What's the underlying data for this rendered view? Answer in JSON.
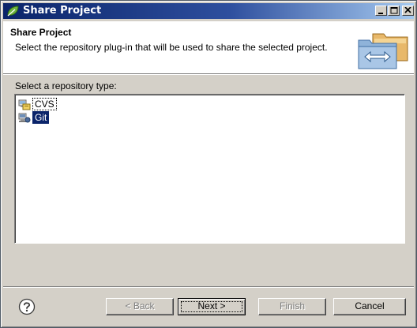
{
  "window": {
    "title": "Share Project"
  },
  "header": {
    "title": "Share Project",
    "description": "Select the repository plug-in that will be used to share the selected project."
  },
  "repository": {
    "label": "Select a repository type:",
    "items": [
      {
        "label": "CVS",
        "icon": "cvs-icon",
        "selected": false
      },
      {
        "label": "Git",
        "icon": "git-icon",
        "selected": true
      }
    ]
  },
  "buttons": {
    "back": "< Back",
    "next": "Next >",
    "finish": "Finish",
    "cancel": "Cancel"
  },
  "colors": {
    "title_bar_start": "#0a246a",
    "title_bar_end": "#a6caf0",
    "selection": "#0a246a",
    "dialog_bg": "#d4d0c8"
  }
}
